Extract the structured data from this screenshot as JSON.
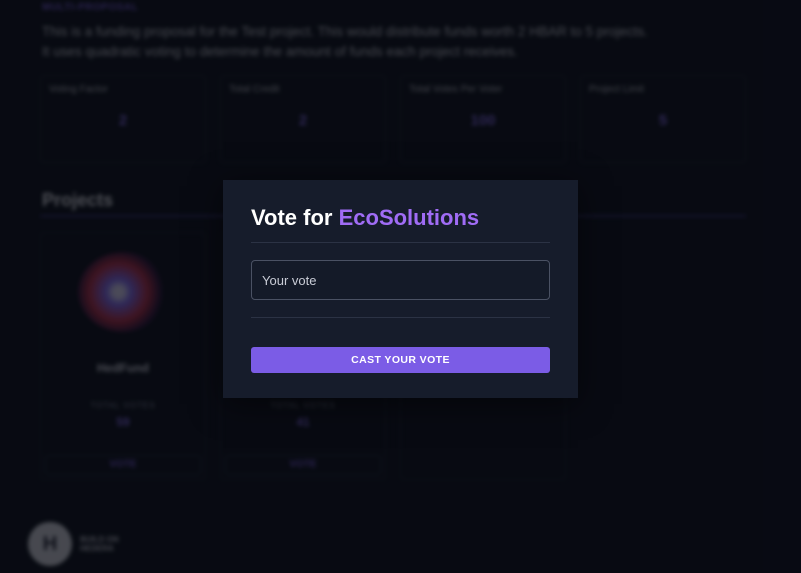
{
  "page": {
    "tag": "MULTI-PROPOSAL",
    "description_line1": "This is a funding proposal for the Test project. This would distribute funds worth 2 HBAR to 5 projects.",
    "description_line2": "It uses quadratic voting to determine the amount of funds each project receives.",
    "stats": [
      {
        "label": "Voting Factor",
        "value": "2"
      },
      {
        "label": "Total Credit",
        "value": "2"
      },
      {
        "label": "Total Votes Per Voter",
        "value": "100"
      },
      {
        "label": "Project Limit",
        "value": "5"
      }
    ],
    "section_title": "Projects",
    "projects": [
      {
        "name": "HedFund",
        "votes_label": "TOTAL VOTES",
        "votes": "59",
        "vote_label": "VOTE"
      },
      {
        "name": "",
        "votes_label": "TOTAL VOTES",
        "votes": "41",
        "vote_label": "VOTE"
      }
    ],
    "logo": {
      "line1": "BUILD ON",
      "line2": "HEDERA",
      "glyph": "H"
    }
  },
  "modal": {
    "title_prefix": "Vote for ",
    "project_name": "EcoSolutions",
    "vote_placeholder": "Your vote",
    "cast_button_label": "CAST YOUR VOTE"
  },
  "colors": {
    "accent": "#a06cf5",
    "button": "#7b5ce6",
    "modal_bg": "#161c2b",
    "page_bg": "#0b0e18"
  }
}
